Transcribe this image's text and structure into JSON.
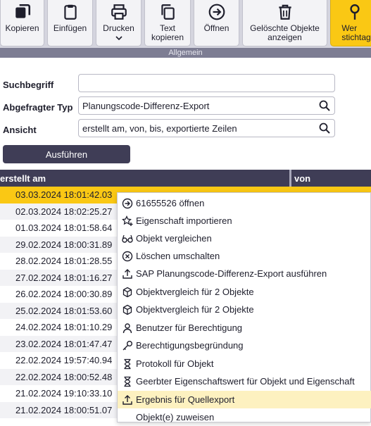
{
  "toolbar": {
    "buttons": [
      {
        "label": "Kopieren",
        "icon": "copy-filled-icon"
      },
      {
        "label": "Einfügen",
        "icon": "clipboard-icon"
      },
      {
        "label": "Drucken",
        "icon": "printer-icon"
      },
      {
        "label": "Text\nkopieren",
        "icon": "copy-outline-icon"
      },
      {
        "label": "Öffnen",
        "icon": "arrow-circle-icon"
      },
      {
        "label": "Gelöschte Objekte\nanzeigen",
        "icon": "trash-icon"
      },
      {
        "label": "Wer\nstichtag",
        "icon": "pin-icon"
      }
    ],
    "group_label": "Allgemein"
  },
  "form": {
    "search_label": "Suchbegriff",
    "search_value": "",
    "type_label": "Abgefragter Typ",
    "type_value": "Planungscode-Differenz-Export",
    "view_label": "Ansicht",
    "view_value": "erstellt am, von, bis, exportierte Zeilen",
    "run_label": "Ausführen"
  },
  "table": {
    "columns": [
      "erstellt am",
      "von"
    ],
    "rows": [
      "03.03.2024 18:01:42.03",
      "02.03.2024 18:02:25.27",
      "01.03.2024 18:01:58.64",
      "29.02.2024 18:00:31.89",
      "28.02.2024 18:01:28.55",
      "27.02.2024 18:01:16.27",
      "26.02.2024 18:00:30.89",
      "25.02.2024 18:01:53.60",
      "24.02.2024 18:01:10.29",
      "23.02.2024 18:01:47.47",
      "22.02.2024 19:57:40.94",
      "22.02.2024 18:00:52.48",
      "21.02.2024 19:10:33.10",
      "21.02.2024 18:00:51.07"
    ]
  },
  "context_menu": {
    "items": [
      {
        "label": "61655526 öffnen",
        "icon": "arrow-circle-icon"
      },
      {
        "label": "Eigenschaft importieren",
        "icon": "star-plus-icon"
      },
      {
        "label": "Objekt vergleichen",
        "icon": "glasses-icon"
      },
      {
        "label": "Löschen umschalten",
        "icon": "x-circle-icon"
      },
      {
        "label": "SAP Planungscode-Differenz-Export ausführen",
        "icon": "upload-icon"
      },
      {
        "label": "Objektvergleich für 2 Objekte",
        "icon": "cube-icon"
      },
      {
        "label": "Objektvergleich für 2 Objekte",
        "icon": "cube-icon"
      },
      {
        "label": "Benutzer für Berechtigung",
        "icon": "user-icon"
      },
      {
        "label": "Berechtigungsbegründung",
        "icon": "key-icon"
      },
      {
        "label": "Protokoll für Objekt",
        "icon": "hourglass-icon"
      },
      {
        "label": "Geerbter Eigenschaftswert für Objekt und Eigenschaft",
        "icon": "hourglass-icon"
      },
      {
        "label": "Ergebnis für Quellexport",
        "icon": "upload-icon"
      },
      {
        "label": "Objekt(e) zuweisen",
        "icon": ""
      }
    ]
  }
}
